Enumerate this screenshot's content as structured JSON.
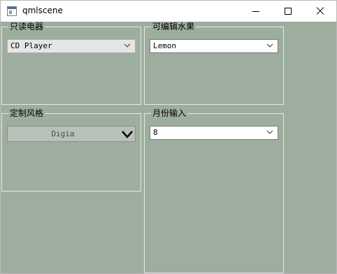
{
  "window": {
    "title": "qmlscene"
  },
  "groups": [
    {
      "title": "只读电器",
      "combo_value": "CD Player"
    },
    {
      "title": "可编辑水果",
      "combo_value": "Lemon"
    },
    {
      "title": "定制风格",
      "combo_value": "Digia"
    },
    {
      "title": "月份输入",
      "combo_value": "8"
    }
  ],
  "colors": {
    "background": "#9eae9e",
    "titlebar": "#ffffff",
    "group_border": "#e4e9e4",
    "custom_combo_bg": "#b9c0b9"
  },
  "icons": {
    "app": "qmlscene-app-icon",
    "minimize": "minimize-icon",
    "maximize": "maximize-icon",
    "close": "close-icon",
    "dropdown": "chevron-down-icon"
  }
}
